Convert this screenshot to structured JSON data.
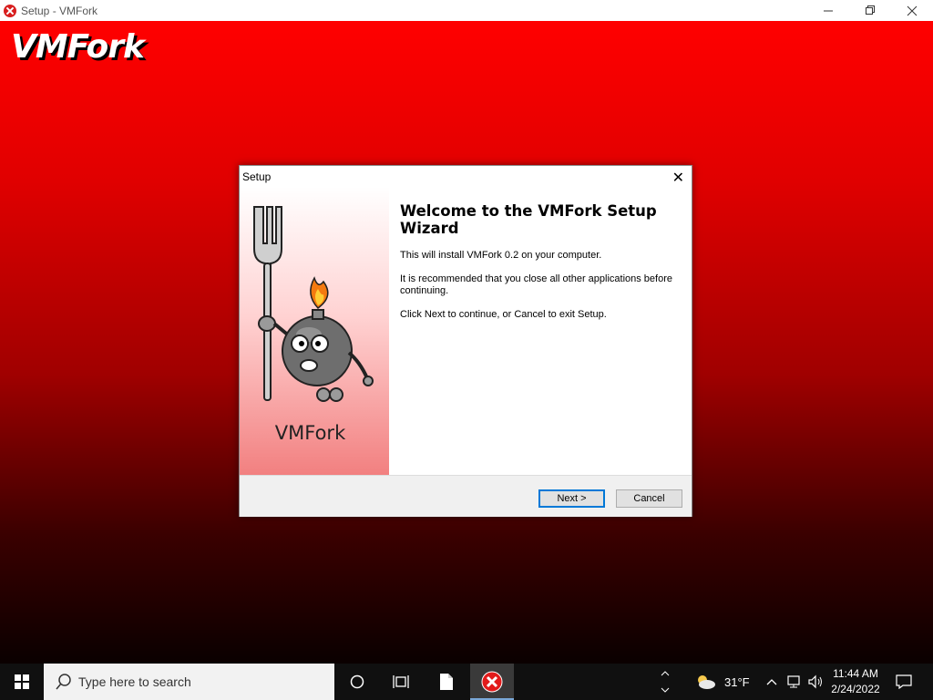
{
  "window": {
    "title": "Setup - VMFork",
    "controls": [
      "minimize-icon",
      "restore-icon",
      "close-icon"
    ]
  },
  "backdrop": {
    "brand_text": "VMFork",
    "colors": {
      "top": "#ff0000",
      "bottom": "#0a0000"
    }
  },
  "dialog": {
    "title": "Setup",
    "close_glyph": "✕",
    "side_brand": "VMFork",
    "heading": "Welcome to the VMFork Setup Wizard",
    "paragraphs": [
      "This will install VMFork 0.2 on your computer.",
      "It is recommended that you close all other applications before continuing.",
      "Click Next to continue, or Cancel to exit Setup."
    ],
    "buttons": {
      "next": "Next >",
      "cancel": "Cancel"
    },
    "accent": "#0078d7"
  },
  "taskbar": {
    "search_placeholder": "Type here to search",
    "weather_temp": "31°F",
    "time": "11:44 AM",
    "date": "2/24/2022",
    "icons": [
      "windows-start-icon",
      "search-icon",
      "cortana-icon",
      "task-view-icon",
      "file-icon",
      "vmfork-setup-icon",
      "weather-icon",
      "chevron-up-icon",
      "network-icon",
      "volume-icon",
      "notification-icon"
    ]
  }
}
